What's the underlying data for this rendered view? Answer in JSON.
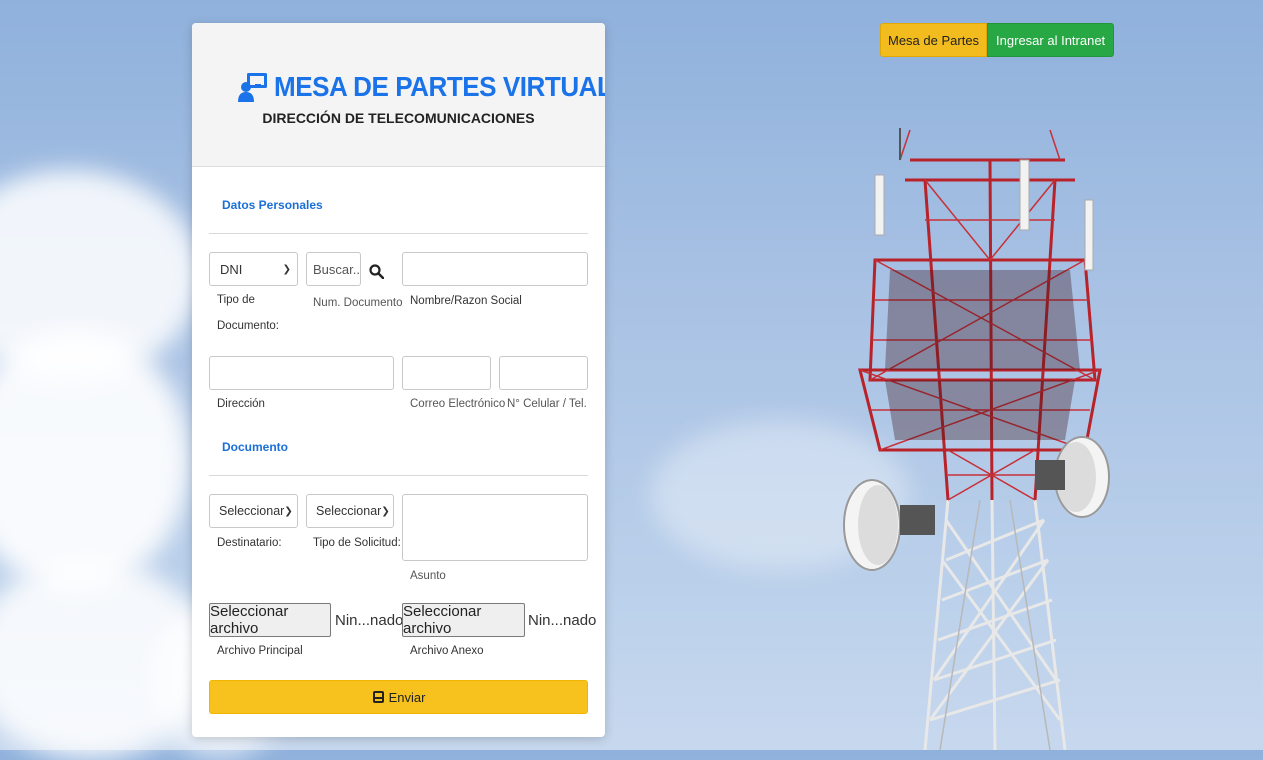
{
  "top_nav": {
    "mesa_label": "Mesa de Partes",
    "intranet_label": "Ingresar al Intranet"
  },
  "header": {
    "title": "MESA DE PARTES VIRTUAL",
    "subtitle": "DIRECCIÓN DE TELECOMUNICACIONES",
    "icon": "user-screen-icon"
  },
  "personal": {
    "section_title": "Datos Personales",
    "doc_type": {
      "value": "DNI",
      "label": "Tipo de Documento:"
    },
    "doc_number": {
      "placeholder": "Buscar..",
      "label": "Num. Documento"
    },
    "name": {
      "value": "",
      "label": "Nombre/Razon Social"
    },
    "address": {
      "value": "",
      "label": "Dirección"
    },
    "email": {
      "value": "",
      "label": "Correo Electrónico"
    },
    "phone": {
      "value": "",
      "label": "N° Celular / Tel."
    }
  },
  "document": {
    "section_title": "Documento",
    "recipient": {
      "value": "Seleccionar",
      "label": "Destinatario:"
    },
    "request_type": {
      "value": "Seleccionar",
      "label": "Tipo de Solicitud:"
    },
    "subject": {
      "value": "",
      "label": "Asunto"
    },
    "main_file": {
      "button": "Seleccionar archivo",
      "status": "Nin...nado",
      "label": "Archivo Principal"
    },
    "annex_file": {
      "button": "Seleccionar archivo",
      "status": "Nin...nado",
      "label": "Archivo Anexo"
    }
  },
  "submit": {
    "label": "Enviar",
    "icon": "send-icon"
  },
  "colors": {
    "accent_blue": "#1a73e8",
    "yellow": "#f7c21d",
    "green": "#28a745"
  }
}
